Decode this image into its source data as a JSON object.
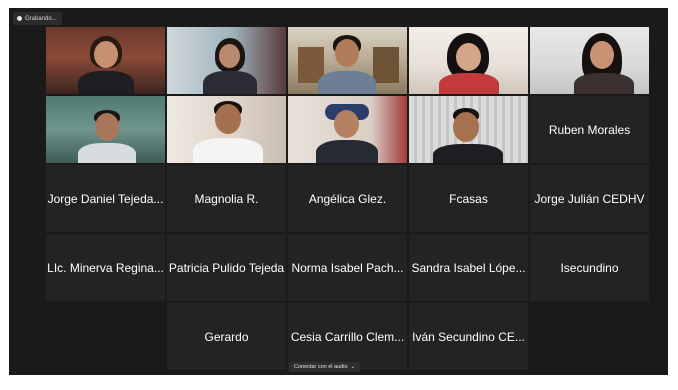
{
  "meeting": {
    "recording_label": "Grabando...",
    "audio_toast": "Conectar con el audio",
    "active_speaker_color": "#c9e86b"
  },
  "participants_video": [
    {
      "id": "v1"
    },
    {
      "id": "v2"
    },
    {
      "id": "v3"
    },
    {
      "id": "v4"
    },
    {
      "id": "v5"
    },
    {
      "id": "v6"
    },
    {
      "id": "v7"
    },
    {
      "id": "v8"
    },
    {
      "id": "v9"
    }
  ],
  "participants_named": [
    "Ruben Morales",
    "Jorge Daniel Tejeda...",
    "Magnolia R.",
    "Angélica Glez.",
    "Fcasas",
    "Jorge Julián CEDHV",
    "LIc. Minerva Regina...",
    "Patricia Pulido Tejeda",
    "Norma Isabel Pach...",
    "Sandra Isabel Lópe...",
    "Isecundino",
    "Gerardo",
    "Cesia Carrillo Clem...",
    "Iván Secundino CE..."
  ]
}
